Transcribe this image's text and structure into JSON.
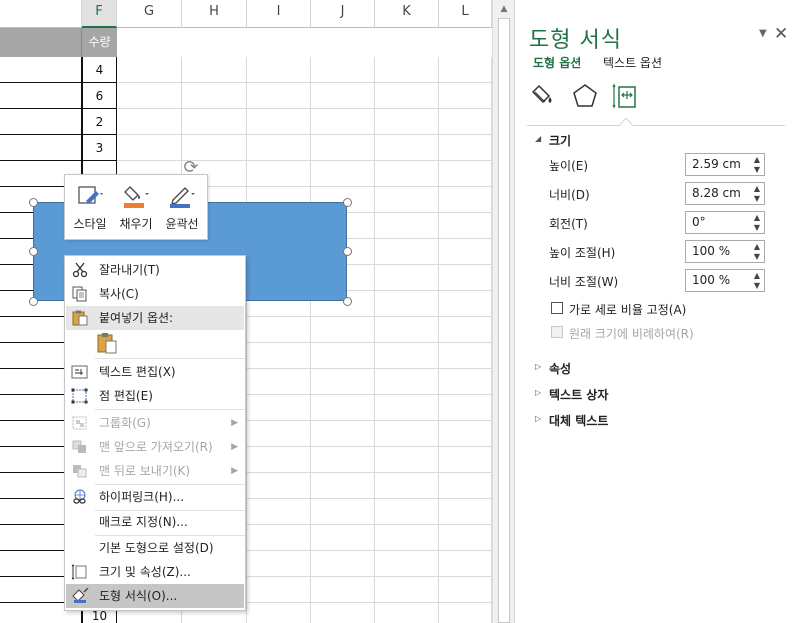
{
  "sheet": {
    "columns": [
      "F",
      "G",
      "H",
      "I",
      "J",
      "K",
      "L"
    ],
    "header_cell": "수량",
    "values": [
      "4",
      "6",
      "2",
      "3",
      "10"
    ]
  },
  "mini_toolbar": {
    "style_label": "스타일",
    "fill_label": "채우기",
    "outline_label": "윤곽선"
  },
  "context_menu": {
    "items": [
      {
        "label": "잘라내기(T)",
        "icon": "scissors-icon"
      },
      {
        "label": "복사(C)",
        "icon": "copy-icon"
      },
      {
        "label": "붙여넣기 옵션:",
        "icon": "paste-icon"
      },
      {
        "label": "텍스트 편집(X)",
        "icon": "edit-text-icon"
      },
      {
        "label": "점 편집(E)",
        "icon": "edit-points-icon"
      },
      {
        "label": "그룹화(G)",
        "icon": "group-icon"
      },
      {
        "label": "맨 앞으로 가져오기(R)",
        "icon": "bring-front-icon"
      },
      {
        "label": "맨 뒤로 보내기(K)",
        "icon": "send-back-icon"
      },
      {
        "label": "하이퍼링크(H)...",
        "icon": "hyperlink-icon"
      },
      {
        "label": "매크로 지정(N)...",
        "icon": ""
      },
      {
        "label": "기본 도형으로 설정(D)",
        "icon": ""
      },
      {
        "label": "크기 및 속성(Z)...",
        "icon": "size-properties-icon"
      },
      {
        "label": "도형 서식(O)...",
        "icon": "format-shape-icon"
      }
    ]
  },
  "pane": {
    "title": "도형 서식",
    "tab_shape": "도형 옵션",
    "tab_text": "텍스트 옵션",
    "section_size": "크기",
    "height_label": "높이(E)",
    "height_value": "2.59 cm",
    "width_label": "너비(D)",
    "width_value": "8.28 cm",
    "rotation_label": "회전(T)",
    "rotation_value": "0°",
    "scale_h_label": "높이 조절(H)",
    "scale_h_value": "100 %",
    "scale_w_label": "너비 조절(W)",
    "scale_w_value": "100 %",
    "lock_aspect_label": "가로 세로 비율 고정(A)",
    "relative_label": "원래 크기에 비례하여(R)",
    "section_properties": "속성",
    "section_textbox": "텍스트 상자",
    "section_alt": "대체 텍스트"
  },
  "colors": {
    "accent": "#217346",
    "shape_fill": "#5b9bd5",
    "fill_bar": "#ed7d31",
    "outline_bar": "#4472c4"
  }
}
